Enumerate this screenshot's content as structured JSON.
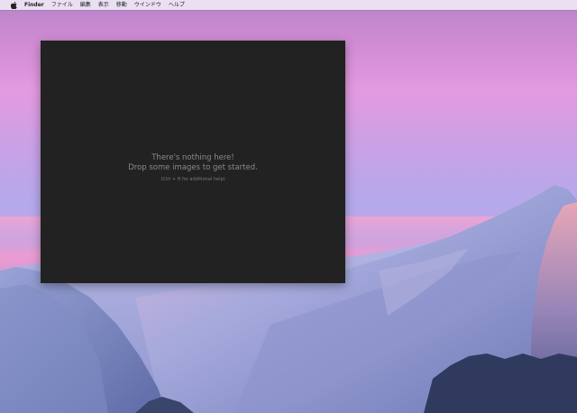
{
  "menubar": {
    "apple_icon": "apple-icon",
    "items": [
      "Finder",
      "ファイル",
      "編集",
      "表示",
      "移動",
      "ウインドウ",
      "ヘルプ"
    ]
  },
  "window": {
    "background": "#222222",
    "empty_state": {
      "line1": "There's nothing here!",
      "line2": "Drop some images to get started.",
      "hint": "(Ctrl + H for additional help)"
    }
  },
  "colors": {
    "menubar": "#eee8f4",
    "text_muted": "#8a8a8a"
  }
}
